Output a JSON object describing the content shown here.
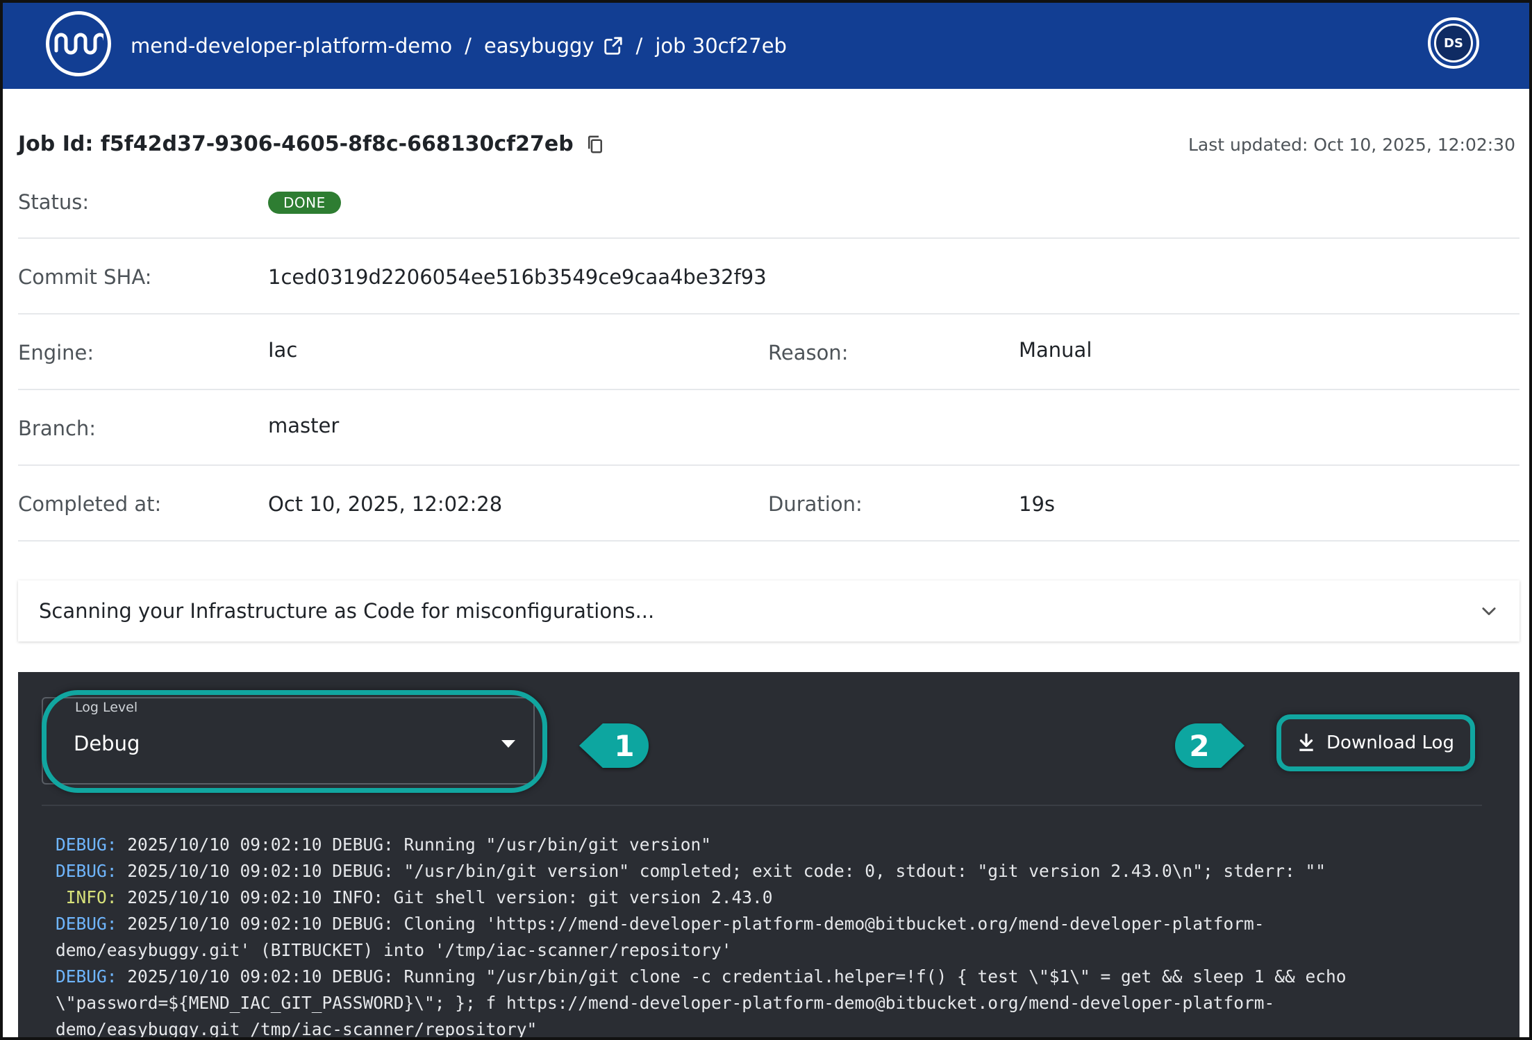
{
  "header": {
    "breadcrumbs": [
      "mend-developer-platform-demo",
      "easybuggy",
      "job 30cf27eb"
    ],
    "separator": "/",
    "avatar_initials": "DS",
    "bg_color": "#123e93"
  },
  "job": {
    "id_label": "Job Id: f5f42d37-9306-4605-8f8c-668130cf27eb",
    "last_updated": "Last updated: Oct 10, 2025, 12:02:30"
  },
  "details": {
    "status_label": "Status:",
    "status_value": "DONE",
    "commit_label": "Commit SHA:",
    "commit_value": "1ced0319d2206054ee516b3549ce9caa4be32f93",
    "engine_label": "Engine:",
    "engine_value": "Iac",
    "reason_label": "Reason:",
    "reason_value": "Manual",
    "branch_label": "Branch:",
    "branch_value": "master",
    "completed_label": "Completed at:",
    "completed_value": "Oct 10, 2025, 12:02:28",
    "duration_label": "Duration:",
    "duration_value": "19s"
  },
  "accordion": {
    "title": "Scanning your Infrastructure as Code for misconfigurations..."
  },
  "log_panel": {
    "level_legend": "Log Level",
    "level_value": "Debug",
    "download_label": "Download Log",
    "marker_1": "1",
    "marker_2": "2",
    "highlight_color": "#11a6a0",
    "lines": [
      {
        "level": "DEBUG:",
        "text": " 2025/10/10 09:02:10 DEBUG: Running \"/usr/bin/git version\""
      },
      {
        "level": "DEBUG:",
        "text": " 2025/10/10 09:02:10 DEBUG: \"/usr/bin/git version\" completed; exit code: 0, stdout: \"git version 2.43.0\\n\"; stderr: \"\""
      },
      {
        "level": " INFO:",
        "text": " 2025/10/10 09:02:10 INFO: Git shell version: git version 2.43.0"
      },
      {
        "level": "DEBUG:",
        "text": " 2025/10/10 09:02:10 DEBUG: Cloning 'https://mend-developer-platform-demo@bitbucket.org/mend-developer-platform-"
      },
      {
        "level": "",
        "text": "demo/easybuggy.git' (BITBUCKET) into '/tmp/iac-scanner/repository'"
      },
      {
        "level": "DEBUG:",
        "text": " 2025/10/10 09:02:10 DEBUG: Running \"/usr/bin/git clone -c credential.helper=!f() { test \\\"$1\\\" = get && sleep 1 && echo"
      },
      {
        "level": "",
        "text": "\\\"password=${MEND_IAC_GIT_PASSWORD}\\\"; }; f https://mend-developer-platform-demo@bitbucket.org/mend-developer-platform-"
      },
      {
        "level": "",
        "text": "demo/easybuggy.git /tmp/iac-scanner/repository\""
      }
    ]
  }
}
